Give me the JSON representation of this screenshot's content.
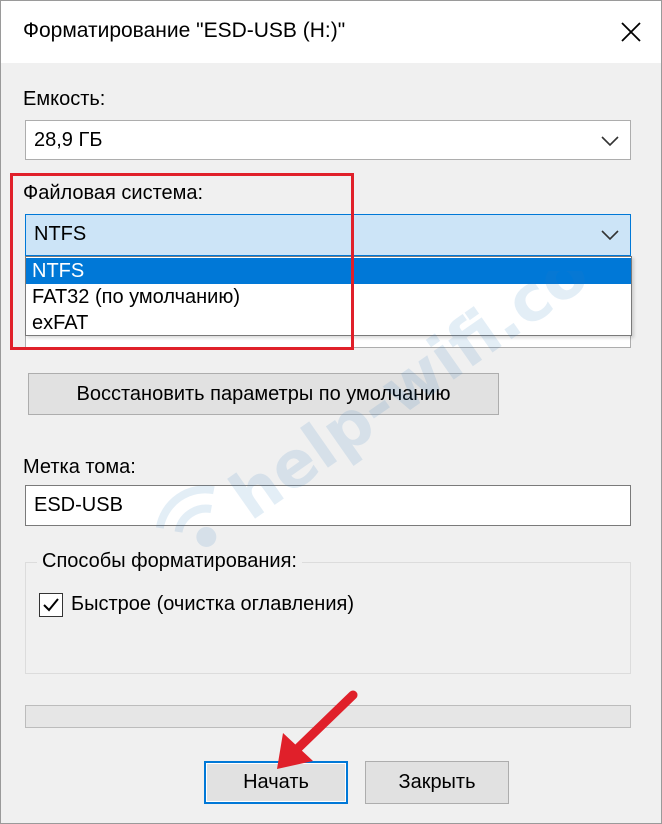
{
  "window": {
    "title": "Форматирование \"ESD-USB (H:)\"",
    "close_icon": "close-icon"
  },
  "capacity": {
    "label": "Емкость:",
    "value": "28,9 ГБ"
  },
  "file_system": {
    "label": "Файловая система:",
    "value": "NTFS",
    "options": [
      "NTFS",
      "FAT32 (по умолчанию)",
      "exFAT"
    ],
    "selected_index": 0
  },
  "restore_button": {
    "label": "Восстановить параметры по умолчанию"
  },
  "volume_label": {
    "label": "Метка тома:",
    "value": "ESD-USB"
  },
  "format_options": {
    "group_title": "Способы форматирования:",
    "quick_format": {
      "label": "Быстрое (очистка оглавления)",
      "checked": true
    }
  },
  "progress": {
    "value": 0
  },
  "actions": {
    "start_label": "Начать",
    "close_label": "Закрыть"
  },
  "watermark": {
    "text": "help-wifi.com"
  },
  "colors": {
    "highlight": "#e0202a",
    "accent": "#0078d7",
    "watermark": "#2f7fc1"
  }
}
